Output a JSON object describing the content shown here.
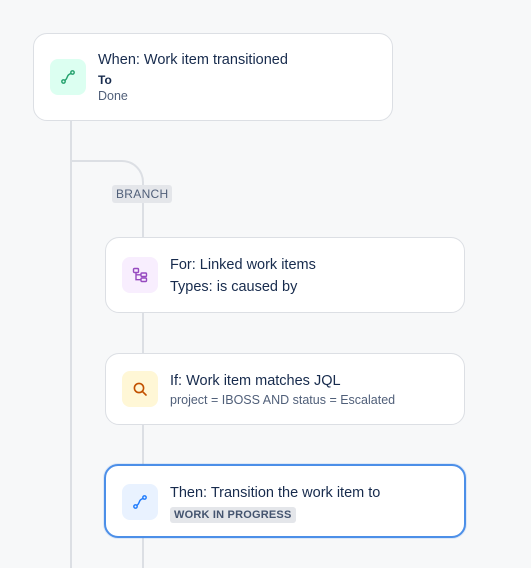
{
  "trigger": {
    "title": "When: Work item transitioned",
    "field_label": "To",
    "field_value": "Done",
    "icon": "transition-icon",
    "icon_bg": "#dcfff1",
    "icon_color": "#22a06b"
  },
  "branch": {
    "label": "BRANCH"
  },
  "for_step": {
    "title": "For: Linked work items",
    "detail": "Types: is caused by",
    "icon": "branch-icon",
    "icon_bg": "#f8eefe",
    "icon_color": "#964ac0"
  },
  "if_step": {
    "title": "If: Work item matches JQL",
    "detail": "project = IBOSS AND status = Escalated",
    "icon": "search-icon",
    "icon_bg": "#fff7d6",
    "icon_color": "#c25100"
  },
  "then_step": {
    "title": "Then: Transition the work item to",
    "status": "WORK IN PROGRESS",
    "icon": "transition-icon",
    "icon_bg": "#e9f2ff",
    "icon_color": "#1d7afc"
  }
}
